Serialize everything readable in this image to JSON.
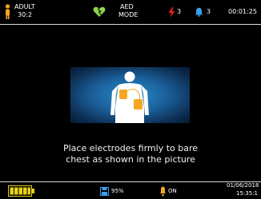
{
  "status_bar": {
    "patient_type": "ADULT",
    "cpr_ratio": "30:2",
    "mode_line1": "AED",
    "mode_line2": "MODE",
    "shock_count": "3",
    "alarm_count": "3",
    "timer": "00:01:25"
  },
  "main": {
    "instruction_line1": "Place electrodes firmly to bare",
    "instruction_line2": "chest as shown in the picture"
  },
  "bottom_bar": {
    "battery_percent": "95%",
    "sound_state": "ON",
    "date": "01/06/2018",
    "time": "15:35:1"
  },
  "colors": {
    "accent_orange": "#f5a623",
    "shock_red": "#e0201a",
    "alarm_blue": "#3aa0e8",
    "heart_green": "#8ed84a",
    "battery_yellow": "#e6d21a"
  },
  "icons": {
    "person": "person-icon",
    "heart": "heart-icon",
    "lightning": "lightning-icon",
    "bell": "bell-icon",
    "battery": "battery-icon",
    "memory": "memory-icon",
    "sound": "sound-icon",
    "electrode_figure": "electrode-placement-icon"
  }
}
